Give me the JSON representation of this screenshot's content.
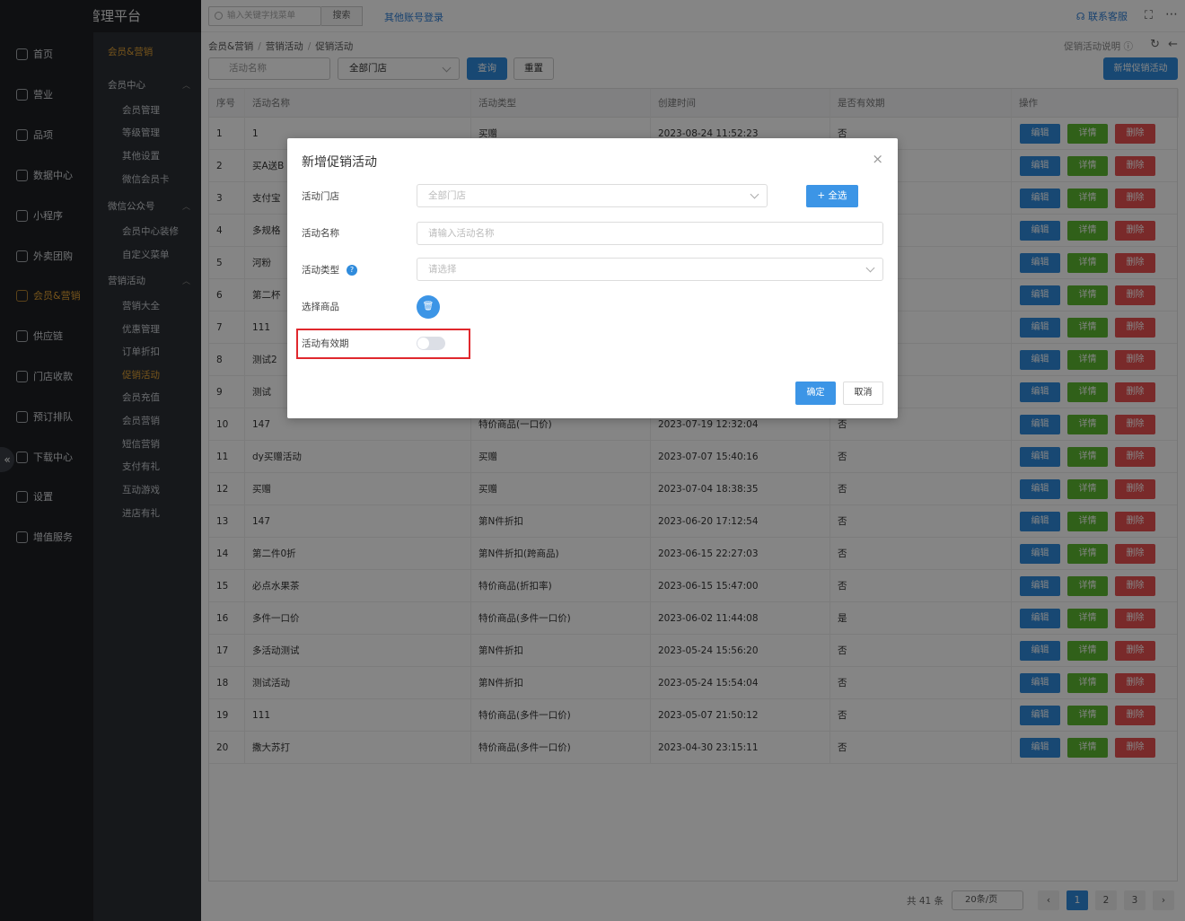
{
  "app": {
    "title": "商户管理平台"
  },
  "topbar": {
    "search_placeholder": "输入关键字找菜单",
    "search_button": "搜索",
    "other_login": "其他账号登录",
    "contact": "联系客服"
  },
  "nav": {
    "items": [
      {
        "label": "首页",
        "icon": "home-icon",
        "active": false
      },
      {
        "label": "营业",
        "icon": "calendar-icon",
        "active": false
      },
      {
        "label": "品项",
        "icon": "bag-icon",
        "active": false
      },
      {
        "label": "数据中心",
        "icon": "share-icon",
        "active": false
      },
      {
        "label": "小程序",
        "icon": "phone-icon",
        "active": false
      },
      {
        "label": "外卖团购",
        "icon": "bike-icon",
        "active": false
      },
      {
        "label": "会员&营销",
        "icon": "user-icon",
        "active": true
      },
      {
        "label": "供应链",
        "icon": "truck-icon",
        "active": false
      },
      {
        "label": "门店收款",
        "icon": "database-icon",
        "active": false
      },
      {
        "label": "预订排队",
        "icon": "clock-icon",
        "active": false
      },
      {
        "label": "下载中心",
        "icon": "download-icon",
        "active": false
      },
      {
        "label": "设置",
        "icon": "gear-icon",
        "active": false
      },
      {
        "label": "增值服务",
        "icon": "alarm-icon",
        "active": false
      }
    ]
  },
  "subnav": {
    "header": "会员&营销",
    "groups": [
      {
        "title": "会员中心",
        "items": [
          "会员管理",
          "等级管理",
          "其他设置",
          "微信会员卡"
        ]
      },
      {
        "title": "微信公众号",
        "items": [
          "会员中心装修",
          "自定义菜单"
        ]
      },
      {
        "title": "营销活动",
        "items": [
          "营销大全",
          "优惠管理",
          "订单折扣",
          "促销活动",
          "会员充值",
          "会员营销",
          "短信营销",
          "支付有礼",
          "互动游戏",
          "进店有礼"
        ]
      }
    ],
    "active_item": "促销活动"
  },
  "breadcrumb": [
    "会员&营销",
    "营销活动",
    "促销活动"
  ],
  "page_help": "促销活动说明",
  "filters": {
    "name_placeholder": "活动名称",
    "store_value": "全部门店",
    "query": "查询",
    "reset": "重置",
    "add": "新增促销活动"
  },
  "table": {
    "headers": [
      "序号",
      "活动名称",
      "活动类型",
      "创建时间",
      "是否有效期",
      "操作"
    ],
    "actions": {
      "edit": "编辑",
      "detail": "详情",
      "delete": "删除"
    },
    "rows": [
      {
        "no": "1",
        "name": "1",
        "type": "买赠",
        "time": "2023-08-24 11:52:23",
        "valid": "否"
      },
      {
        "no": "2",
        "name": "买A送B",
        "type": "",
        "time": "",
        "valid": ""
      },
      {
        "no": "3",
        "name": "支付宝",
        "type": "",
        "time": "",
        "valid": ""
      },
      {
        "no": "4",
        "name": "多规格",
        "type": "",
        "time": "",
        "valid": ""
      },
      {
        "no": "5",
        "name": "河粉",
        "type": "",
        "time": "",
        "valid": ""
      },
      {
        "no": "6",
        "name": "第二杯",
        "type": "",
        "time": "",
        "valid": ""
      },
      {
        "no": "7",
        "name": "111",
        "type": "",
        "time": "",
        "valid": ""
      },
      {
        "no": "8",
        "name": "测试2",
        "type": "",
        "time": "",
        "valid": ""
      },
      {
        "no": "9",
        "name": "测试",
        "type": "",
        "time": "",
        "valid": ""
      },
      {
        "no": "10",
        "name": "147",
        "type": "特价商品(一口价)",
        "time": "2023-07-19 12:32:04",
        "valid": "否"
      },
      {
        "no": "11",
        "name": "dy买赠活动",
        "type": "买赠",
        "time": "2023-07-07 15:40:16",
        "valid": "否"
      },
      {
        "no": "12",
        "name": "买赠",
        "type": "买赠",
        "time": "2023-07-04 18:38:35",
        "valid": "否"
      },
      {
        "no": "13",
        "name": "147",
        "type": "第N件折扣",
        "time": "2023-06-20 17:12:54",
        "valid": "否"
      },
      {
        "no": "14",
        "name": "第二件0折",
        "type": "第N件折扣(跨商品)",
        "time": "2023-06-15 22:27:03",
        "valid": "否"
      },
      {
        "no": "15",
        "name": "必点水果茶",
        "type": "特价商品(折扣率)",
        "time": "2023-06-15 15:47:00",
        "valid": "否"
      },
      {
        "no": "16",
        "name": "多件一口价",
        "type": "特价商品(多件一口价)",
        "time": "2023-06-02 11:44:08",
        "valid": "是"
      },
      {
        "no": "17",
        "name": "多活动测试",
        "type": "第N件折扣",
        "time": "2023-05-24 15:56:20",
        "valid": "否"
      },
      {
        "no": "18",
        "name": "测试活动",
        "type": "第N件折扣",
        "time": "2023-05-24 15:54:04",
        "valid": "否"
      },
      {
        "no": "19",
        "name": "111",
        "type": "特价商品(多件一口价)",
        "time": "2023-05-07 21:50:12",
        "valid": "否"
      },
      {
        "no": "20",
        "name": "撒大苏打",
        "type": "特价商品(多件一口价)",
        "time": "2023-04-30 23:15:11",
        "valid": "否"
      }
    ]
  },
  "pagination": {
    "total": "共 41 条",
    "page_size": "20条/页",
    "pages": [
      "1",
      "2",
      "3"
    ],
    "current": "1",
    "prev": "‹",
    "next": "›"
  },
  "modal": {
    "title": "新增促销活动",
    "close": "×",
    "store_label": "活动门店",
    "store_placeholder": "全部门店",
    "select_all": "+ 全选",
    "name_label": "活动名称",
    "name_placeholder": "请输入活动名称",
    "type_label": "活动类型",
    "type_placeholder": "请选择",
    "goods_label": "选择商品",
    "validity_label": "活动有效期",
    "validity_on": false,
    "ok": "确定",
    "cancel": "取消"
  },
  "colors": {
    "primary": "#2f8bdc",
    "success": "#5cb930",
    "danger": "#e95252",
    "accent": "#e2a235",
    "highlight": "#e0282d"
  }
}
